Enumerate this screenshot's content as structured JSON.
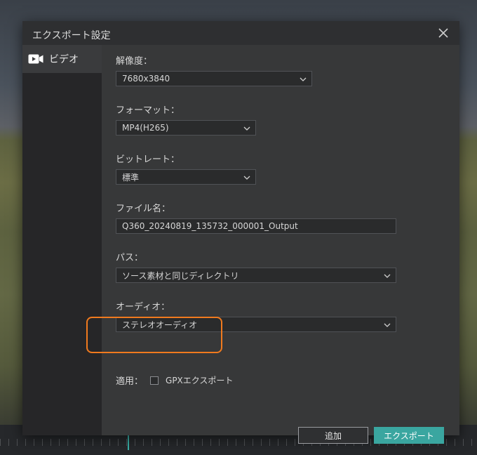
{
  "dialog": {
    "title": "エクスポート設定"
  },
  "sidebar": {
    "items": [
      {
        "label": "ビデオ",
        "icon": "video-camera-icon"
      }
    ]
  },
  "form": {
    "resolution": {
      "label": "解像度：",
      "value": "7680x3840"
    },
    "format": {
      "label": "フォーマット：",
      "value": "MP4(H265)"
    },
    "bitrate": {
      "label": "ビットレート：",
      "value": "標準"
    },
    "filename": {
      "label": "ファイル名：",
      "value": "Q360_20240819_135732_000001_Output"
    },
    "path": {
      "label": "パス：",
      "value": "ソース素材と同じディレクトリ"
    },
    "audio": {
      "label": "オーディオ：",
      "value": "ステレオオーディオ"
    },
    "apply": {
      "label": "適用：",
      "checkbox_label": "GPXエクスポート",
      "checked": false
    }
  },
  "buttons": {
    "add": "追加",
    "export": "エクスポート"
  },
  "colors": {
    "accent": "#3aa6a0",
    "highlight": "#f07a1e"
  }
}
